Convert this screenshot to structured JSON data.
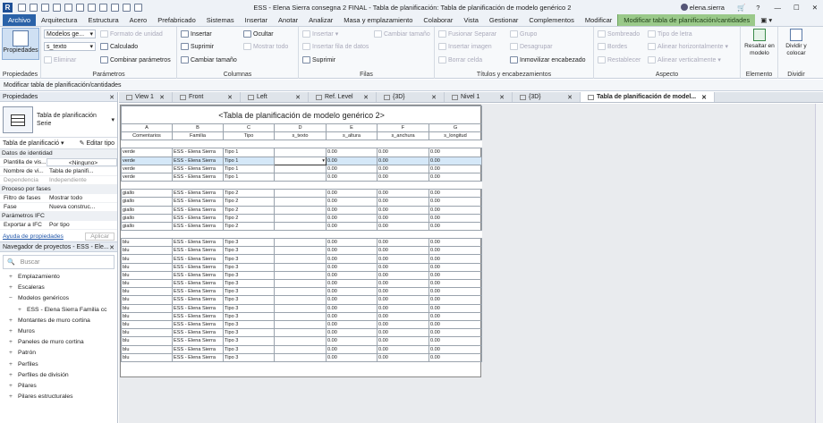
{
  "title_bar": {
    "title": "ESS - Elena Sierra consegna 2 FINAL - Tabla de planificación: Tabla de planificación de modelo genérico 2",
    "user": "elena.sierra"
  },
  "ribbon_tabs": [
    "Archivo",
    "Arquitectura",
    "Estructura",
    "Acero",
    "Prefabricado",
    "Sistemas",
    "Insertar",
    "Anotar",
    "Analizar",
    "Masa y emplazamiento",
    "Colaborar",
    "Vista",
    "Gestionar",
    "Complementos",
    "Modificar"
  ],
  "context_tab": "Modificar tabla de planificación/cantidades",
  "ribbon": {
    "propiedades": {
      "button": "Propiedades",
      "group": "Propiedades"
    },
    "parametros": {
      "dropdown1": "Modelos ge...",
      "dropdown2": "s_texto",
      "formato": "Formato de unidad",
      "calculado": "Calculado",
      "eliminar": "Eliminar",
      "combinar": "Combinar parámetros",
      "group": "Parámetros"
    },
    "columnas": {
      "insertar": "Insertar",
      "suprimir": "Suprimir",
      "cambiar": "Cambiar tamaño",
      "ocultar": "Ocultar",
      "mostrar": "Mostrar todo",
      "group": "Columnas"
    },
    "filas": {
      "insertar": "Insertar",
      "insertar_datos": "Insertar fila de datos",
      "suprimir": "Suprimir",
      "cambiar": "Cambiar tamaño",
      "group": "Filas"
    },
    "titulos": {
      "fusionar": "Fusionar Separar",
      "insertar_imagen": "Insertar imagen",
      "borrar": "Borrar celda",
      "agrupar": "Grupo",
      "desagrupar": "Desagrupar",
      "inmovilizar": "Inmovilizar encabezado",
      "group": "Títulos y encabezamientos"
    },
    "aspecto": {
      "sombreado": "Sombreado",
      "bordes": "Bordes",
      "restablecer": "Restablecer",
      "tipo": "Tipo de letra",
      "alinear_h": "Alinear horizontalmente",
      "alinear_v": "Alinear verticalmente",
      "group": "Aspecto"
    },
    "elemento": {
      "resaltar": "Resaltar en modelo",
      "group": "Elemento"
    },
    "dividir": {
      "label": "Dividir y colocar",
      "group": "Dividir"
    }
  },
  "options_bar": "Modificar tabla de planificación/cantidades",
  "properties": {
    "header": "Propiedades",
    "type_name": "Tabla de planificación",
    "type_sub": "Serie",
    "selector": "Tabla de planificació",
    "edit_type": "Editar tipo",
    "sections": [
      {
        "name": "Datos de identidad",
        "rows": [
          [
            "Plantilla de vis...",
            "<Ninguno>"
          ],
          [
            "Nombre de vi...",
            "Tabla de planifi..."
          ],
          [
            "Dependencia",
            "Independiente"
          ]
        ]
      },
      {
        "name": "Proceso por fases",
        "rows": [
          [
            "Filtro de fases",
            "Mostrar todo"
          ],
          [
            "Fase",
            "Nueva construc..."
          ]
        ]
      },
      {
        "name": "Parámetros IFC",
        "rows": [
          [
            "Exportar a IFC",
            "Por tipo"
          ]
        ]
      }
    ],
    "help": "Ayuda de propiedades",
    "apply": "Aplicar"
  },
  "browser": {
    "header": "Navegador de proyectos - ESS - Ele...",
    "search": "Buscar",
    "items": [
      {
        "label": "Emplazamiento",
        "sym": "+",
        "lvl": 1
      },
      {
        "label": "Escaleras",
        "sym": "+",
        "lvl": 1
      },
      {
        "label": "Modelos genéricos",
        "sym": "−",
        "lvl": 1
      },
      {
        "label": "ESS - Elena Sierra Familia cc",
        "sym": "+",
        "lvl": 2
      },
      {
        "label": "Montantes de muro cortina",
        "sym": "+",
        "lvl": 1
      },
      {
        "label": "Muros",
        "sym": "+",
        "lvl": 1
      },
      {
        "label": "Paneles de muro cortina",
        "sym": "+",
        "lvl": 1
      },
      {
        "label": "Patrón",
        "sym": "+",
        "lvl": 1
      },
      {
        "label": "Perfiles",
        "sym": "+",
        "lvl": 1
      },
      {
        "label": "Perfiles de división",
        "sym": "+",
        "lvl": 1
      },
      {
        "label": "Pilares",
        "sym": "+",
        "lvl": 1
      },
      {
        "label": "Pilares estructurales",
        "sym": "+",
        "lvl": 1
      }
    ]
  },
  "view_tabs": [
    "View 1",
    "Front",
    "Left",
    "Ref. Level",
    "{3D}",
    "Nivel 1",
    "{3D}",
    "Tabla de planificación de model..."
  ],
  "schedule": {
    "title": "<Tabla de planificación de modelo genérico 2>",
    "letters": [
      "A",
      "B",
      "C",
      "D",
      "E",
      "F",
      "G"
    ],
    "headers": [
      "Comentarios",
      "Familia",
      "Tipo",
      "s_texto",
      "s_altura",
      "s_anchura",
      "s_longitud"
    ],
    "groups": [
      {
        "comment": "verde",
        "tipo": "Tipo 1",
        "count": 4
      },
      {
        "comment": "giallo",
        "tipo": "Tipo 2",
        "count": 5
      },
      {
        "comment": "blu",
        "tipo": "Tipo 3",
        "count": 15
      }
    ],
    "familia": "ESS - Elena Sierra",
    "zero": "0.00"
  }
}
